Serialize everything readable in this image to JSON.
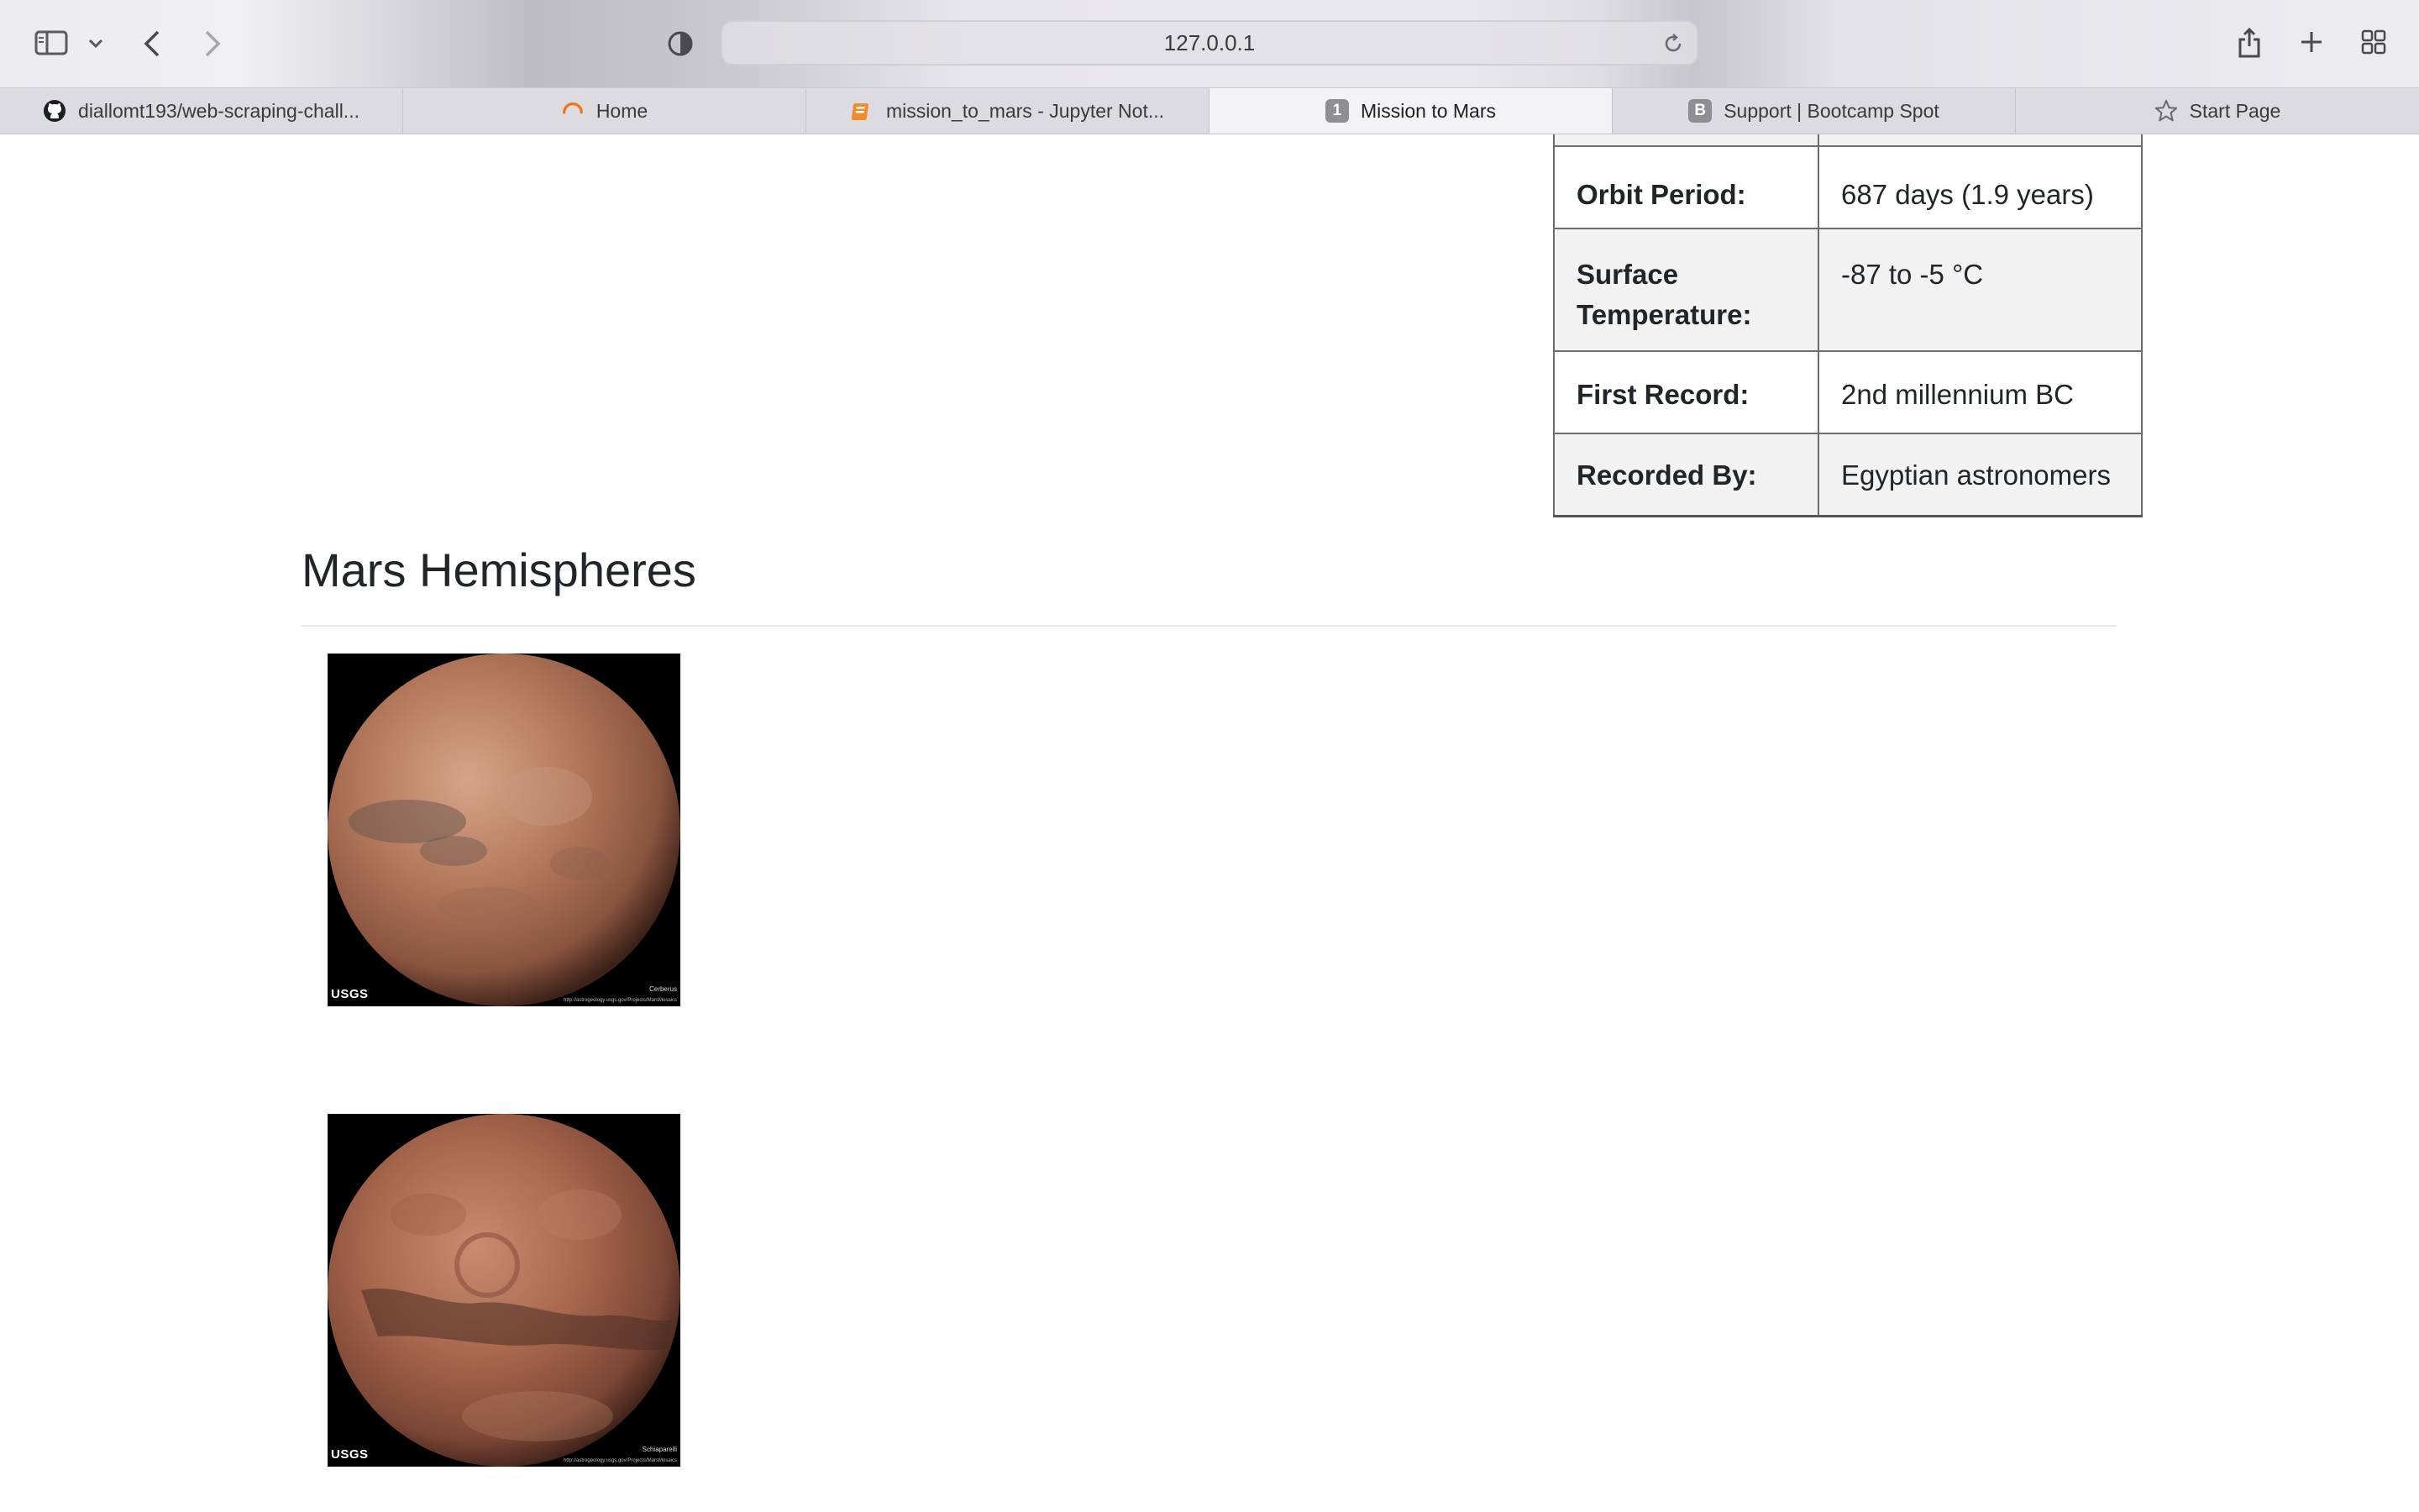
{
  "browser": {
    "address": "127.0.0.1",
    "tabs": [
      {
        "label": "diallomt193/web-scraping-chall...",
        "icon": "github-icon",
        "active": false
      },
      {
        "label": "Home",
        "icon": "loading-spinner-icon",
        "active": false
      },
      {
        "label": "mission_to_mars - Jupyter Not...",
        "icon": "notebook-icon",
        "active": false
      },
      {
        "label": "Mission to Mars",
        "icon": "badge",
        "badge": "1",
        "active": true
      },
      {
        "label": "Support | Bootcamp Spot",
        "icon": "badge",
        "badge": "B",
        "active": false
      },
      {
        "label": "Start Page",
        "icon": "star-icon",
        "active": false
      }
    ]
  },
  "facts": [
    {
      "label": "Orbit Period:",
      "value": "687 days (1.9 years)"
    },
    {
      "label": "Surface Temperature:",
      "value": "-87 to -5 °C"
    },
    {
      "label": "First Record:",
      "value": "2nd millennium BC"
    },
    {
      "label": "Recorded By:",
      "value": "Egyptian astronomers"
    }
  ],
  "hemispheres": {
    "title": "Mars Hemispheres",
    "images": [
      {
        "logo": "USGS",
        "caption": "Cerberus",
        "url": "http://astrogeology.usgs.gov/Projects/MarsMosaics"
      },
      {
        "logo": "USGS",
        "caption": "Schiaparelli",
        "url": "http://astrogeology.usgs.gov/Projects/MarsMosaics"
      }
    ]
  },
  "colors": {
    "accent": "#212529",
    "tab_active": "#f3f3f5",
    "mars": "#b5765a"
  }
}
